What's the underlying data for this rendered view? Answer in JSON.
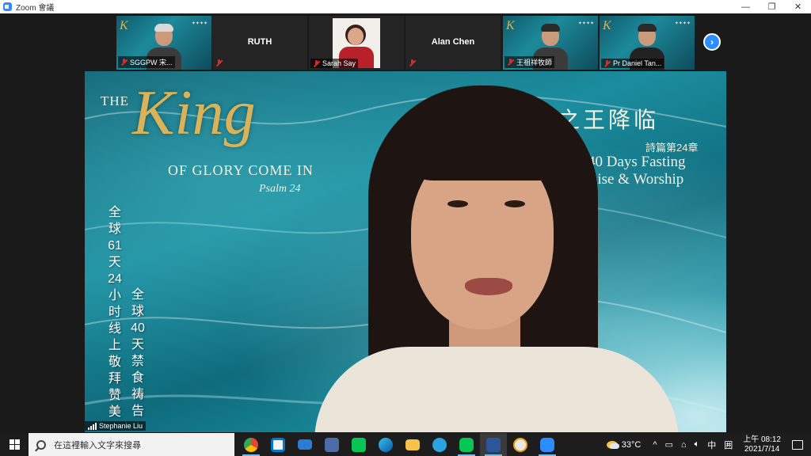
{
  "window": {
    "title": "Zoom 會議",
    "controls": [
      "—",
      "❐",
      "✕"
    ]
  },
  "participants": [
    {
      "name": "SGGPW 宋...",
      "muted": true,
      "has_video": true
    },
    {
      "name": "RUTH",
      "muted": true,
      "has_video": false
    },
    {
      "name": "Sarah Say",
      "muted": true,
      "has_video": true
    },
    {
      "name": "Alan Chen",
      "muted": true,
      "has_video": false
    },
    {
      "name": "王祖祥牧師",
      "muted": true,
      "has_video": true
    },
    {
      "name": "Pr Daniel Tan...",
      "muted": true,
      "has_video": true
    }
  ],
  "next_button": "›",
  "active_speaker": {
    "name": "Stephanie Liu",
    "background": {
      "the": "THE",
      "king": "King",
      "glory": "OF GLORY COME IN",
      "psalm": "Psalm 24",
      "cn_title": "耀之王降临",
      "psalm_cn": "詩篇第24章",
      "fasting": "40 Days Fasting",
      "praise": "Praise & Worship",
      "col1": "全球61天24小时线上敬拜赞美",
      "col2": "全球40天禁食祷告"
    }
  },
  "taskbar": {
    "search_placeholder": "在這裡輸入文字來搜尋",
    "weather": "33°C",
    "tray_chevron": "^",
    "ime": "中",
    "ime2": "囲",
    "time": "上午 08:12",
    "date": "2021/7/14",
    "app_icons": [
      "chrome-icon",
      "store-icon",
      "mail-icon",
      "save-icon",
      "line-icon",
      "edge-icon",
      "folder-icon",
      "telegram-icon",
      "line-green-icon",
      "word-icon",
      "paint-icon",
      "zoom-icon"
    ]
  }
}
